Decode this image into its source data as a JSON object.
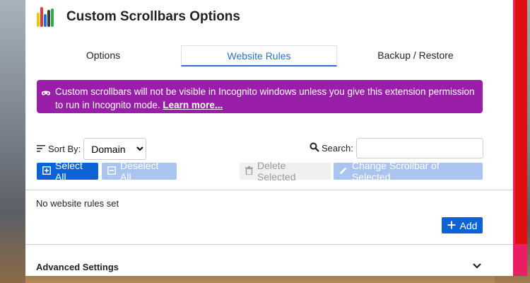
{
  "header": {
    "title": "Custom Scrollbars Options",
    "logo_icon": "scrollbars-logo-icon",
    "logo_colors": [
      "#f4c20d",
      "#e53935",
      "#1a73e8",
      "#3c3c3c",
      "#34a853"
    ]
  },
  "tabs": [
    {
      "label": "Options",
      "active": false
    },
    {
      "label": "Website Rules",
      "active": true
    },
    {
      "label": "Backup / Restore",
      "active": false
    }
  ],
  "notice": {
    "icon": "incognito-mask-icon",
    "text": "Custom scrollbars will not be visible in Incognito windows unless you give this extension permission to run in Incognito mode.",
    "link": "Learn more..."
  },
  "sort": {
    "icon": "sort-lines-icon",
    "label": "Sort By:",
    "selected": "Domain"
  },
  "search": {
    "icon": "search-icon",
    "label": "Search:",
    "value": ""
  },
  "actions": {
    "select_all": "Select All",
    "deselect_all": "Deselect All",
    "delete_selected": "Delete Selected",
    "change_scrollbar": "Change Scrollbar of Selected"
  },
  "rules": {
    "empty_text": "No website rules set",
    "add_label": "Add"
  },
  "advanced": {
    "label": "Advanced Settings"
  },
  "colors": {
    "accent": "#0b63d6",
    "notice_bg": "#9a1fa8",
    "scrollbar_track": "#e91e63",
    "scrollbar_thumb": "#e00f0f"
  }
}
